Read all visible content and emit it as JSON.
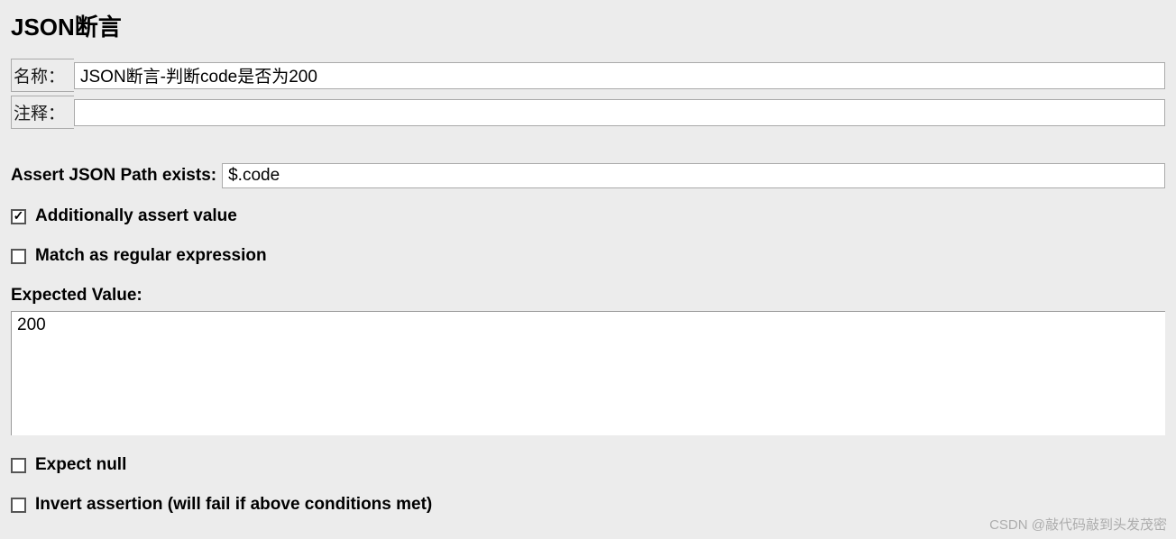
{
  "title": "JSON断言",
  "fields": {
    "name_label": "名称：",
    "name_value": "JSON断言-判断code是否为200",
    "comment_label": "注释：",
    "comment_value": ""
  },
  "assert_path": {
    "label": "Assert JSON Path exists:",
    "value": "$.code"
  },
  "checks": {
    "additionally_assert_value": {
      "label": "Additionally assert value",
      "checked": true
    },
    "match_regex": {
      "label": "Match as regular expression",
      "checked": false
    },
    "expect_null": {
      "label": "Expect null",
      "checked": false
    },
    "invert_assertion": {
      "label": "Invert assertion (will fail if above conditions met)",
      "checked": false
    }
  },
  "expected": {
    "label": "Expected Value:",
    "value": "200"
  },
  "watermark": "CSDN @敲代码敲到头发茂密"
}
